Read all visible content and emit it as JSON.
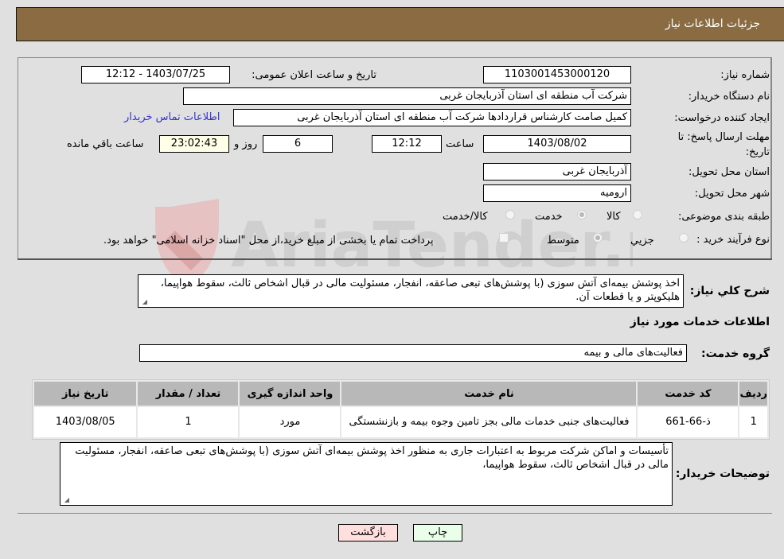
{
  "header": {
    "title": "جزئیات اطلاعات نیاز"
  },
  "form": {
    "need_number_label": "شماره نیاز:",
    "need_number": "1103001453000120",
    "announce_label": "تاریخ و ساعت اعلان عمومی:",
    "announce_value": "1403/07/25 - 12:12",
    "buyer_org_label": "نام دستگاه خریدار:",
    "buyer_org": "شرکت آب منطقه ای استان آذربایجان غربی",
    "creator_label": "ایجاد کننده درخواست:",
    "creator": "کمیل صامت کارشناس قراردادها شرکت آب منطقه ای استان آذربایجان غربی",
    "contact_link": "اطلاعات تماس خریدار",
    "deadline_label": "مهلت ارسال پاسخ: تا تاریخ:",
    "deadline_date": "1403/08/02",
    "time_label": "ساعت",
    "deadline_time": "12:12",
    "days_value": "6",
    "days_label": "روز و",
    "remaining_time": "23:02:43",
    "remaining_label": "ساعت باقي مانده",
    "province_label": "استان محل تحویل:",
    "province": "آذربایجان غربی",
    "city_label": "شهر محل تحویل:",
    "city": "ارومیه",
    "category_label": "طبقه بندی موضوعی:",
    "category_options": [
      "کالا",
      "خدمت",
      "کالا/خدمت"
    ],
    "category_selected": "خدمت",
    "process_label": "نوع فرآیند خرید :",
    "process_options": [
      "جزيي",
      "متوسط"
    ],
    "process_selected": "متوسط",
    "treasury_checkbox_label": "پرداخت تمام یا بخشی از مبلغ خرید،از محل \"اسناد خزانه اسلامی\" خواهد بود.",
    "treasury_checked": false
  },
  "summary": {
    "label": "شرح كلي نياز:",
    "text": "اخذ پوشش بیمه‌ای آتش سوزی (با پوشش‌های تبعی صاعقه، انفجار، مسئولیت مالی در قبال اشخاص ثالث، سقوط هواپیما، هلیکوپتر و یا قطعات آن."
  },
  "services": {
    "section_title": "اطلاعات خدمات مورد نیاز",
    "group_label": "گروه خدمت:",
    "group_value": "فعالیت‌های مالی و بیمه",
    "table": {
      "headers": [
        "ردیف",
        "کد خدمت",
        "نام خدمت",
        "واحد اندازه گیری",
        "تعداد / مقدار",
        "تاریخ نیاز"
      ],
      "rows": [
        [
          "1",
          "ذ-66-661",
          "فعالیت‌های جنبی خدمات مالی بجز تامین وجوه بیمه و بازنشستگی",
          "مورد",
          "1",
          "1403/08/05"
        ]
      ]
    }
  },
  "buyer_notes": {
    "label": "توضیحات خریدار:",
    "text": "تأسیسات و اماکن شرکت مربوط به اعتبارات جاری به منظور اخذ پوشش بیمه‌ای آتش سوزی (با پوشش‌های تبعی صاعقه، انفجار، مسئولیت مالی در قبال اشخاص ثالث، سقوط هواپیما،"
  },
  "buttons": {
    "print": "چاپ",
    "back": "بازگشت"
  },
  "colors": {
    "header_bg": "#8b6c42",
    "print_bg": "#eaffea",
    "back_bg": "#ffdede"
  },
  "watermark": {
    "text": "AriaTender.neT"
  }
}
